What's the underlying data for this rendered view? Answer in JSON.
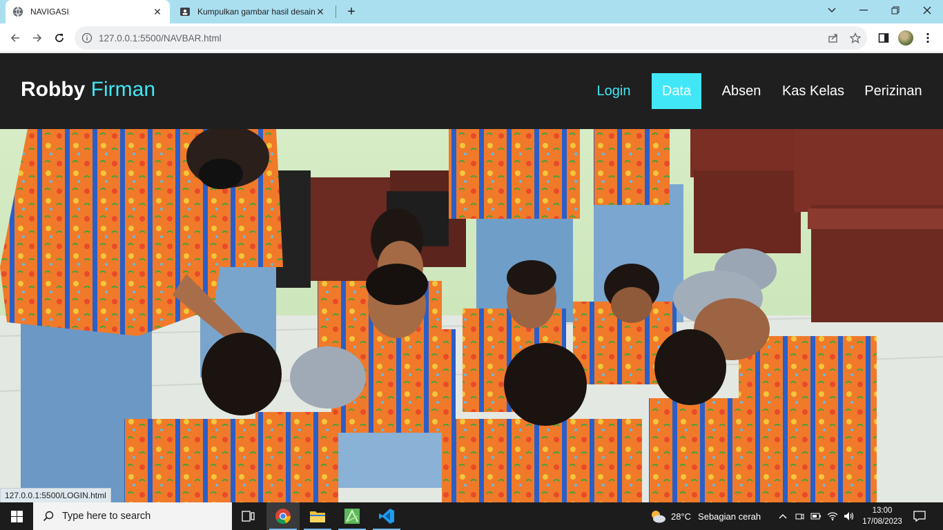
{
  "browser": {
    "tabs": [
      {
        "title": "NAVIGASI",
        "active": true,
        "favicon": "globe-icon"
      },
      {
        "title": "Kumpulkan gambar hasil desain w",
        "active": false,
        "favicon": "classroom-icon"
      }
    ],
    "url": {
      "host": "127.0.0.1",
      "rest": ":5500/NAVBAR.html"
    },
    "status_url": "127.0.0.1:5500/LOGIN.html"
  },
  "page": {
    "brand": {
      "first": "Robby",
      "second": "Firman"
    },
    "nav": [
      {
        "label": "Login",
        "state": "highlight"
      },
      {
        "label": "Data",
        "state": "active"
      },
      {
        "label": "Absen",
        "state": "normal"
      },
      {
        "label": "Kas Kelas",
        "state": "normal"
      },
      {
        "label": "Perizinan",
        "state": "normal"
      }
    ],
    "hero_image": "photo of students in orange batik shirts sitting on classroom floor"
  },
  "taskbar": {
    "search_placeholder": "Type here to search",
    "weather": {
      "temp": "28°C",
      "desc": "Sebagian cerah"
    },
    "time": "13:00",
    "date": "17/08/2023"
  },
  "colors": {
    "accent": "#41e7f7",
    "navbar_bg": "#1f1f1f",
    "tabstrip": "#aadff0"
  }
}
